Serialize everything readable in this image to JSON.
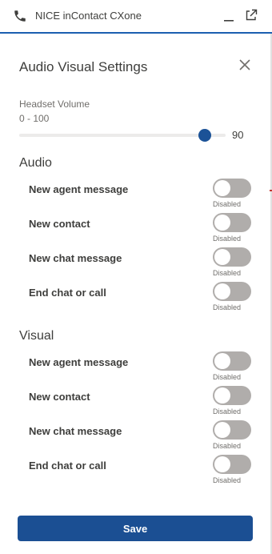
{
  "app": {
    "title": "NICE inContact CXone",
    "icons": [
      "phone-icon",
      "minimize-icon",
      "popout-icon"
    ]
  },
  "panel": {
    "title": "Audio Visual Settings",
    "close_icon": "close-icon"
  },
  "volume": {
    "label": "Headset Volume",
    "range": "0 - 100",
    "min": 0,
    "max": 100,
    "value": 90,
    "value_text": "90"
  },
  "audio": {
    "heading": "Audio",
    "items": [
      {
        "label": "New agent message",
        "status": "Disabled",
        "enabled": false
      },
      {
        "label": "New contact",
        "status": "Disabled",
        "enabled": false
      },
      {
        "label": "New chat message",
        "status": "Disabled",
        "enabled": false
      },
      {
        "label": "End chat or call",
        "status": "Disabled",
        "enabled": false
      }
    ]
  },
  "visual": {
    "heading": "Visual",
    "items": [
      {
        "label": "New agent message",
        "status": "Disabled",
        "enabled": false
      },
      {
        "label": "New contact",
        "status": "Disabled",
        "enabled": false
      },
      {
        "label": "New chat message",
        "status": "Disabled",
        "enabled": false
      },
      {
        "label": "End chat or call",
        "status": "Disabled",
        "enabled": false
      }
    ]
  },
  "actions": {
    "save_label": "Save"
  },
  "colors": {
    "accent": "#1b5297",
    "save_button": "#1b4f93",
    "toggle_off": "#b0adab",
    "header_border": "#1b5fb0"
  }
}
